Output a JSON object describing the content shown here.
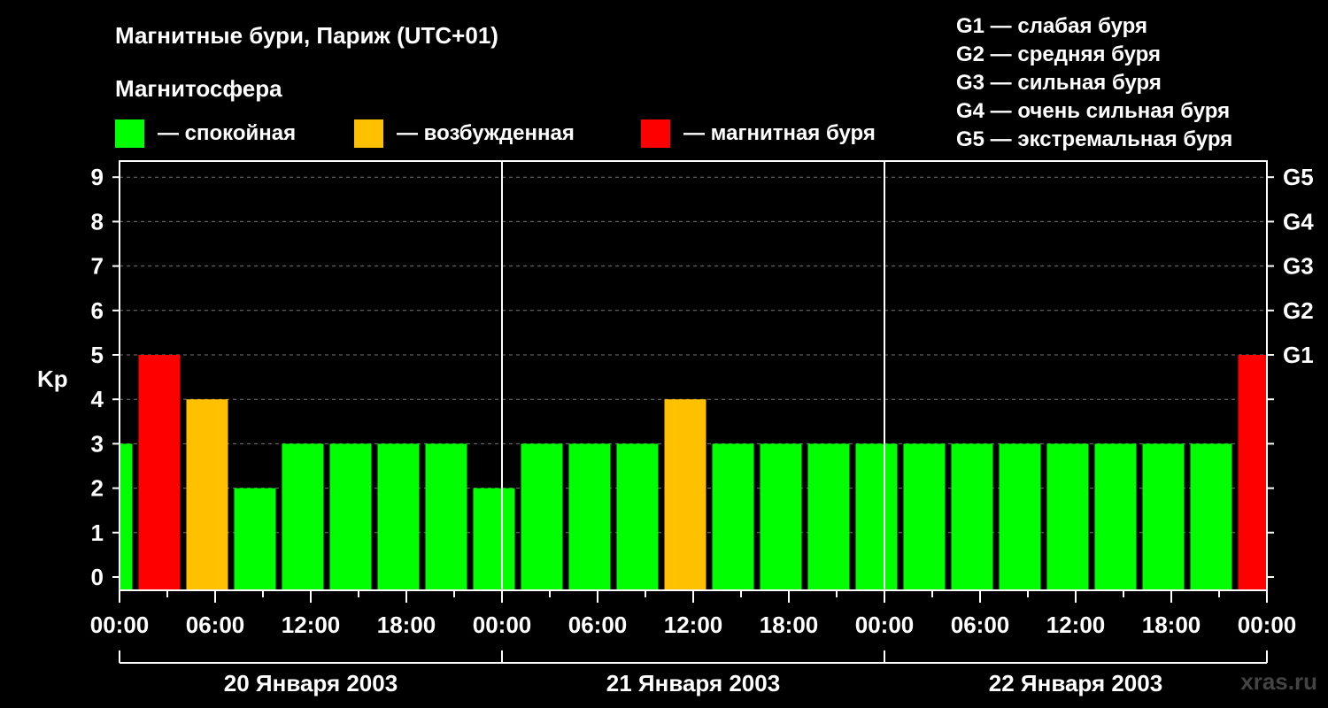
{
  "chart_data": {
    "type": "bar",
    "title": "Магнитные бури, Париж (UTC+01)",
    "legend_title": "Магнитосфера",
    "legend": [
      {
        "label": "— спокойная",
        "color": "#00ff00"
      },
      {
        "label": "— возбужденная",
        "color": "#ffc000"
      },
      {
        "label": "— магнитная буря",
        "color": "#ff0000"
      }
    ],
    "storm_scale": [
      "G1 — слабая буря",
      "G2 — средняя буря",
      "G3 — сильная буря",
      "G4 — очень сильная буря",
      "G5 — экстремальная буря"
    ],
    "ylabel": "Kp",
    "ylim": [
      0,
      9
    ],
    "yticks": [
      0,
      1,
      2,
      3,
      4,
      5,
      6,
      7,
      8,
      9
    ],
    "right_ticks": [
      {
        "value": 5,
        "label": "G1"
      },
      {
        "value": 6,
        "label": "G2"
      },
      {
        "value": 7,
        "label": "G3"
      },
      {
        "value": 8,
        "label": "G4"
      },
      {
        "value": 9,
        "label": "G5"
      }
    ],
    "x_range_hours": [
      0,
      72
    ],
    "x_tick_labels": [
      "00:00",
      "06:00",
      "12:00",
      "18:00",
      "00:00",
      "06:00",
      "12:00",
      "18:00",
      "00:00",
      "06:00",
      "12:00",
      "18:00",
      "00:00"
    ],
    "days": [
      "20 Января 2003",
      "21 Января 2003",
      "22 Января 2003"
    ],
    "grid": true,
    "bars": [
      {
        "start": "00:00",
        "end": "01:00",
        "day": "20 Января 2003",
        "value": 3
      },
      {
        "start": "01:00",
        "end": "04:00",
        "day": "20 Января 2003",
        "value": 5
      },
      {
        "start": "04:00",
        "end": "07:00",
        "day": "20 Января 2003",
        "value": 4
      },
      {
        "start": "07:00",
        "end": "10:00",
        "day": "20 Января 2003",
        "value": 2
      },
      {
        "start": "10:00",
        "end": "13:00",
        "day": "20 Января 2003",
        "value": 3
      },
      {
        "start": "13:00",
        "end": "16:00",
        "day": "20 Января 2003",
        "value": 3
      },
      {
        "start": "16:00",
        "end": "19:00",
        "day": "20 Января 2003",
        "value": 3
      },
      {
        "start": "19:00",
        "end": "22:00",
        "day": "20 Января 2003",
        "value": 3
      },
      {
        "start": "22:00",
        "end": "01:00",
        "day": "20 Января 2003",
        "value": 2
      },
      {
        "start": "01:00",
        "end": "04:00",
        "day": "21 Января 2003",
        "value": 3
      },
      {
        "start": "04:00",
        "end": "07:00",
        "day": "21 Января 2003",
        "value": 3
      },
      {
        "start": "07:00",
        "end": "10:00",
        "day": "21 Января 2003",
        "value": 3
      },
      {
        "start": "10:00",
        "end": "13:00",
        "day": "21 Января 2003",
        "value": 4
      },
      {
        "start": "13:00",
        "end": "16:00",
        "day": "21 Января 2003",
        "value": 3
      },
      {
        "start": "16:00",
        "end": "19:00",
        "day": "21 Января 2003",
        "value": 3
      },
      {
        "start": "19:00",
        "end": "22:00",
        "day": "21 Января 2003",
        "value": 3
      },
      {
        "start": "22:00",
        "end": "01:00",
        "day": "21 Января 2003",
        "value": 3
      },
      {
        "start": "01:00",
        "end": "04:00",
        "day": "22 Января 2003",
        "value": 3
      },
      {
        "start": "04:00",
        "end": "07:00",
        "day": "22 Января 2003",
        "value": 3
      },
      {
        "start": "07:00",
        "end": "10:00",
        "day": "22 Января 2003",
        "value": 3
      },
      {
        "start": "10:00",
        "end": "13:00",
        "day": "22 Января 2003",
        "value": 3
      },
      {
        "start": "13:00",
        "end": "16:00",
        "day": "22 Января 2003",
        "value": 3
      },
      {
        "start": "16:00",
        "end": "19:00",
        "day": "22 Января 2003",
        "value": 3
      },
      {
        "start": "19:00",
        "end": "22:00",
        "day": "22 Января 2003",
        "value": 3
      },
      {
        "start": "22:00",
        "end": "00:00",
        "day": "22 Января 2003",
        "value": 5
      }
    ],
    "colors": {
      "quiet": "#00ff00",
      "active": "#ffc000",
      "storm": "#ff0000",
      "background": "#000000"
    },
    "watermark": "xras.ru"
  }
}
